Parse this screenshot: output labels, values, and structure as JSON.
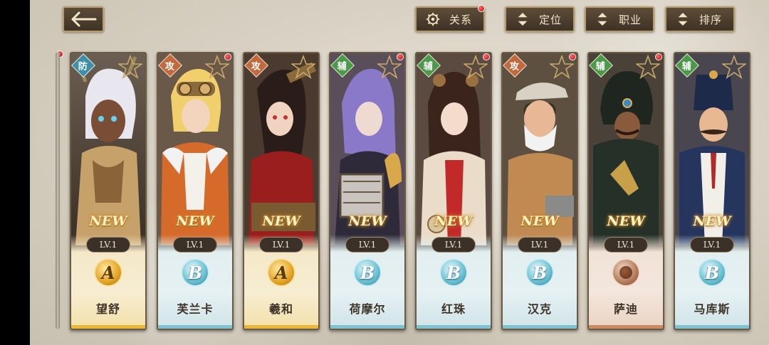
{
  "back_button": {
    "icon": "back-arrow-icon"
  },
  "top_buttons": [
    {
      "label": "关系",
      "icon": "gear-hand-icon",
      "badge": true
    },
    {
      "label": "定位",
      "icon": "sort-arrows-icon",
      "badge": false
    },
    {
      "label": "职业",
      "icon": "sort-arrows-icon",
      "badge": false
    },
    {
      "label": "排序",
      "icon": "sort-arrows-icon",
      "badge": false
    }
  ],
  "cards": [
    {
      "name": "望舒",
      "role": "防",
      "role_type": "def",
      "level": "LV.1",
      "new": "NEW",
      "rank": "A",
      "rank_style": "A",
      "badge": false
    },
    {
      "name": "芙兰卡",
      "role": "攻",
      "role_type": "atk",
      "level": "LV.1",
      "new": "NEW",
      "rank": "B",
      "rank_style": "B",
      "badge": true
    },
    {
      "name": "羲和",
      "role": "攻",
      "role_type": "atk",
      "level": "LV.1",
      "new": "NEW",
      "rank": "A",
      "rank_style": "A",
      "badge": false
    },
    {
      "name": "荷摩尔",
      "role": "辅",
      "role_type": "sup",
      "level": "LV.1",
      "new": "NEW",
      "rank": "B",
      "rank_style": "B",
      "badge": true
    },
    {
      "name": "红珠",
      "role": "辅",
      "role_type": "sup",
      "level": "LV.1",
      "new": "NEW",
      "rank": "B",
      "rank_style": "B",
      "badge": true
    },
    {
      "name": "汉克",
      "role": "攻",
      "role_type": "atk",
      "level": "LV.1",
      "new": "NEW",
      "rank": "B",
      "rank_style": "B",
      "badge": true
    },
    {
      "name": "萨迪",
      "role": "辅",
      "role_type": "sup",
      "level": "LV.1",
      "new": "NEW",
      "rank": "",
      "rank_style": "C",
      "badge": true
    },
    {
      "name": "马库斯",
      "role": "辅",
      "role_type": "sup",
      "level": "LV.1",
      "new": "NEW",
      "rank": "B",
      "rank_style": "B",
      "badge": false
    }
  ],
  "colors": {
    "card_frame": "#6b5a44",
    "rank_gold": "#e3a322",
    "rank_blue": "#66bfd1",
    "rank_bronze": "#b47a5a",
    "notification": "#c40000"
  }
}
